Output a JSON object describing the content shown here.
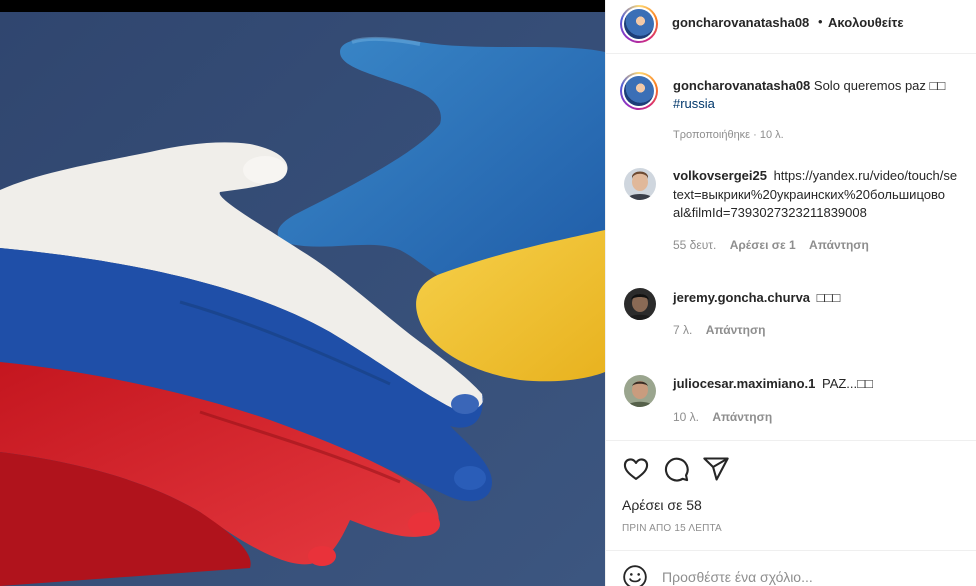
{
  "post": {
    "author": "goncharovanatasha08",
    "follow_separator": "•",
    "follow_label": "Ακολουθείτε"
  },
  "caption": {
    "username": "goncharovanatasha08",
    "text": "Solo queremos paz",
    "emoji_glyphs": "□□",
    "hashtag": "#russia",
    "edited_meta": "Τροποποιήθηκε · 10 λ."
  },
  "comments": [
    {
      "username": "volkovsergei25",
      "lines": [
        "https://yandex.ru/video/touch/se",
        "text=выкрики%20украинских%20большицово",
        "al&filmId=7393027323211839008"
      ],
      "time": "55 δευτ.",
      "likes": "Αρέσει σε 1",
      "reply": "Απάντηση"
    },
    {
      "username": "jeremy.goncha.churva",
      "text": "□□□",
      "time": "7 λ.",
      "reply": "Απάντηση"
    },
    {
      "username": "juliocesar.maximiano.1",
      "text": "PAZ...□□",
      "time": "10 λ.",
      "reply": "Απάντηση"
    }
  ],
  "actions": {
    "icons": [
      "heart-icon",
      "comment-icon",
      "share-icon"
    ],
    "likes_label": "Αρέσει σε 58",
    "posted_time": "ΠΡΙΝ ΑΠΟ 15 ΛΕΠΤΑ"
  },
  "add_comment": {
    "placeholder": "Προσθέστε ένα σχόλιο..."
  },
  "colors": {
    "link": "#00376b",
    "muted": "#8e8e8e",
    "text": "#262626",
    "russia_white": "#f2f2f2",
    "russia_blue": "#1f4fa8",
    "russia_red": "#d2222d",
    "ukraine_blue": "#2a6fbf",
    "ukraine_yellow": "#f1c232",
    "background": "#2c3e67"
  }
}
